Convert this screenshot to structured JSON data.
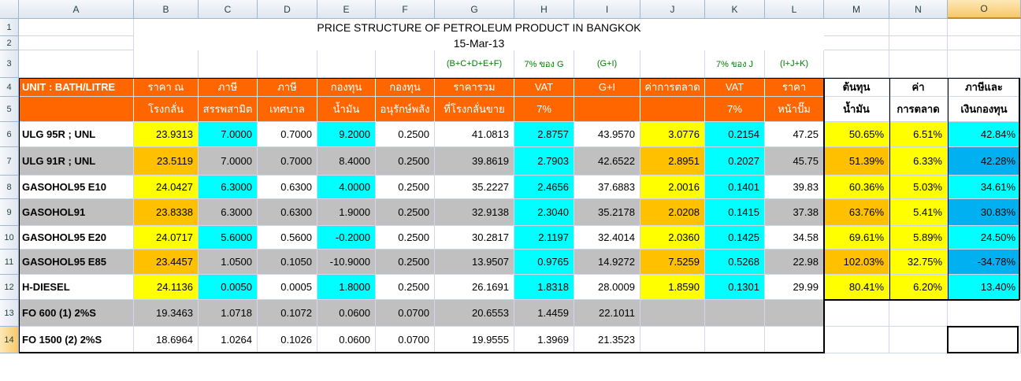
{
  "columns": [
    "A",
    "B",
    "C",
    "D",
    "E",
    "F",
    "G",
    "H",
    "I",
    "J",
    "K",
    "L",
    "M",
    "N",
    "O"
  ],
  "selected_column": "O",
  "rows": [
    "1",
    "2",
    "3",
    "4",
    "5",
    "6",
    "7",
    "8",
    "9",
    "10",
    "11",
    "12",
    "13",
    "14"
  ],
  "selected_row": "14",
  "title": "PRICE STRUCTURE OF PETROLEUM PRODUCT IN BANGKOK",
  "date": "15-Mar-13",
  "formula_labels": {
    "G": "(B+C+D+E+F)",
    "H": "7% ของ G",
    "I": "(G+I)",
    "K": "7% ของ J",
    "L": "(I+J+K)"
  },
  "header_row1": {
    "A": "UNIT : BATH/LITRE",
    "B": "ราคา ณ",
    "C": "ภาษี",
    "D": "ภาษี",
    "E": "กองทุน",
    "F": "กองทุน",
    "G": "ราคารวม",
    "H": "VAT",
    "I": "G+I",
    "J": "ค่าการตลาด",
    "K": "VAT",
    "L": "ราคา",
    "M": "ต้นทุน",
    "N": "ค่า",
    "O": "ภาษีและ"
  },
  "header_row2": {
    "B": "โรงกลั่น",
    "C": "สรรพสามิต",
    "D": "เทศบาล",
    "E": "น้ำมัน",
    "F": "อนุรักษ์พลัง",
    "G": "ที่โรงกลั่นขาย",
    "H": "7%",
    "K": "7%",
    "L": "หน้าปั๊ม",
    "M": "น้ำมัน",
    "N": "การตลาด",
    "O": "เงินกองทุน"
  },
  "products": [
    {
      "name": "ULG 95R ; UNL",
      "values": [
        "23.9313",
        "7.0000",
        "0.7000",
        "9.2000",
        "0.2500",
        "41.0813",
        "2.8757",
        "43.9570",
        "3.0776",
        "0.2154",
        "47.25",
        "50.65%",
        "6.51%",
        "42.84%"
      ]
    },
    {
      "name": "ULG 91R ; UNL",
      "values": [
        "23.5119",
        "7.0000",
        "0.7000",
        "8.4000",
        "0.2500",
        "39.8619",
        "2.7903",
        "42.6522",
        "2.8951",
        "0.2027",
        "45.75",
        "51.39%",
        "6.33%",
        "42.28%"
      ]
    },
    {
      "name": "GASOHOL95 E10",
      "values": [
        "24.0427",
        "6.3000",
        "0.6300",
        "4.0000",
        "0.2500",
        "35.2227",
        "2.4656",
        "37.6883",
        "2.0016",
        "0.1401",
        "39.83",
        "60.36%",
        "5.03%",
        "34.61%"
      ]
    },
    {
      "name": "GASOHOL91",
      "values": [
        "23.8338",
        "6.3000",
        "0.6300",
        "1.9000",
        "0.2500",
        "32.9138",
        "2.3040",
        "35.2178",
        "2.0208",
        "0.1415",
        "37.38",
        "63.76%",
        "5.41%",
        "30.83%"
      ]
    },
    {
      "name": "GASOHOL95 E20",
      "values": [
        "24.0717",
        "5.6000",
        "0.5600",
        "-0.2000",
        "0.2500",
        "30.2817",
        "2.1197",
        "32.4014",
        "2.0360",
        "0.1425",
        "34.58",
        "69.61%",
        "5.89%",
        "24.50%"
      ]
    },
    {
      "name": "GASOHOL95 E85",
      "values": [
        "23.4457",
        "1.0500",
        "0.1050",
        "-10.9000",
        "0.2500",
        "13.9507",
        "0.9765",
        "14.9272",
        "7.5259",
        "0.5268",
        "22.98",
        "102.03%",
        "32.75%",
        "-34.78%"
      ]
    },
    {
      "name": "H-DIESEL",
      "values": [
        "24.1136",
        "0.0050",
        "0.0005",
        "1.8000",
        "0.2500",
        "26.1691",
        "1.8318",
        "28.0009",
        "1.8590",
        "0.1301",
        "29.99",
        "80.41%",
        "6.20%",
        "13.40%"
      ]
    },
    {
      "name": "FO 600 (1) 2%S",
      "values": [
        "19.3463",
        "1.0718",
        "0.1072",
        "0.0600",
        "0.0700",
        "20.6553",
        "1.4459",
        "22.1011",
        "",
        "",
        "",
        "",
        "",
        ""
      ]
    },
    {
      "name": "FO 1500 (2) 2%S",
      "values": [
        "18.6964",
        "1.0264",
        "0.1026",
        "0.0600",
        "0.0700",
        "19.9555",
        "1.3969",
        "21.3523",
        "",
        "",
        "",
        "",
        "",
        ""
      ]
    }
  ],
  "colors": {
    "header_orange": "#ff6600",
    "yellow": "#ffff00",
    "cyan": "#00ffff",
    "gray": "#c0c0c0",
    "orange": "#ffc000",
    "light_blue": "#33ccff",
    "blue": "#00b0f0",
    "formula_green": "#008000"
  }
}
